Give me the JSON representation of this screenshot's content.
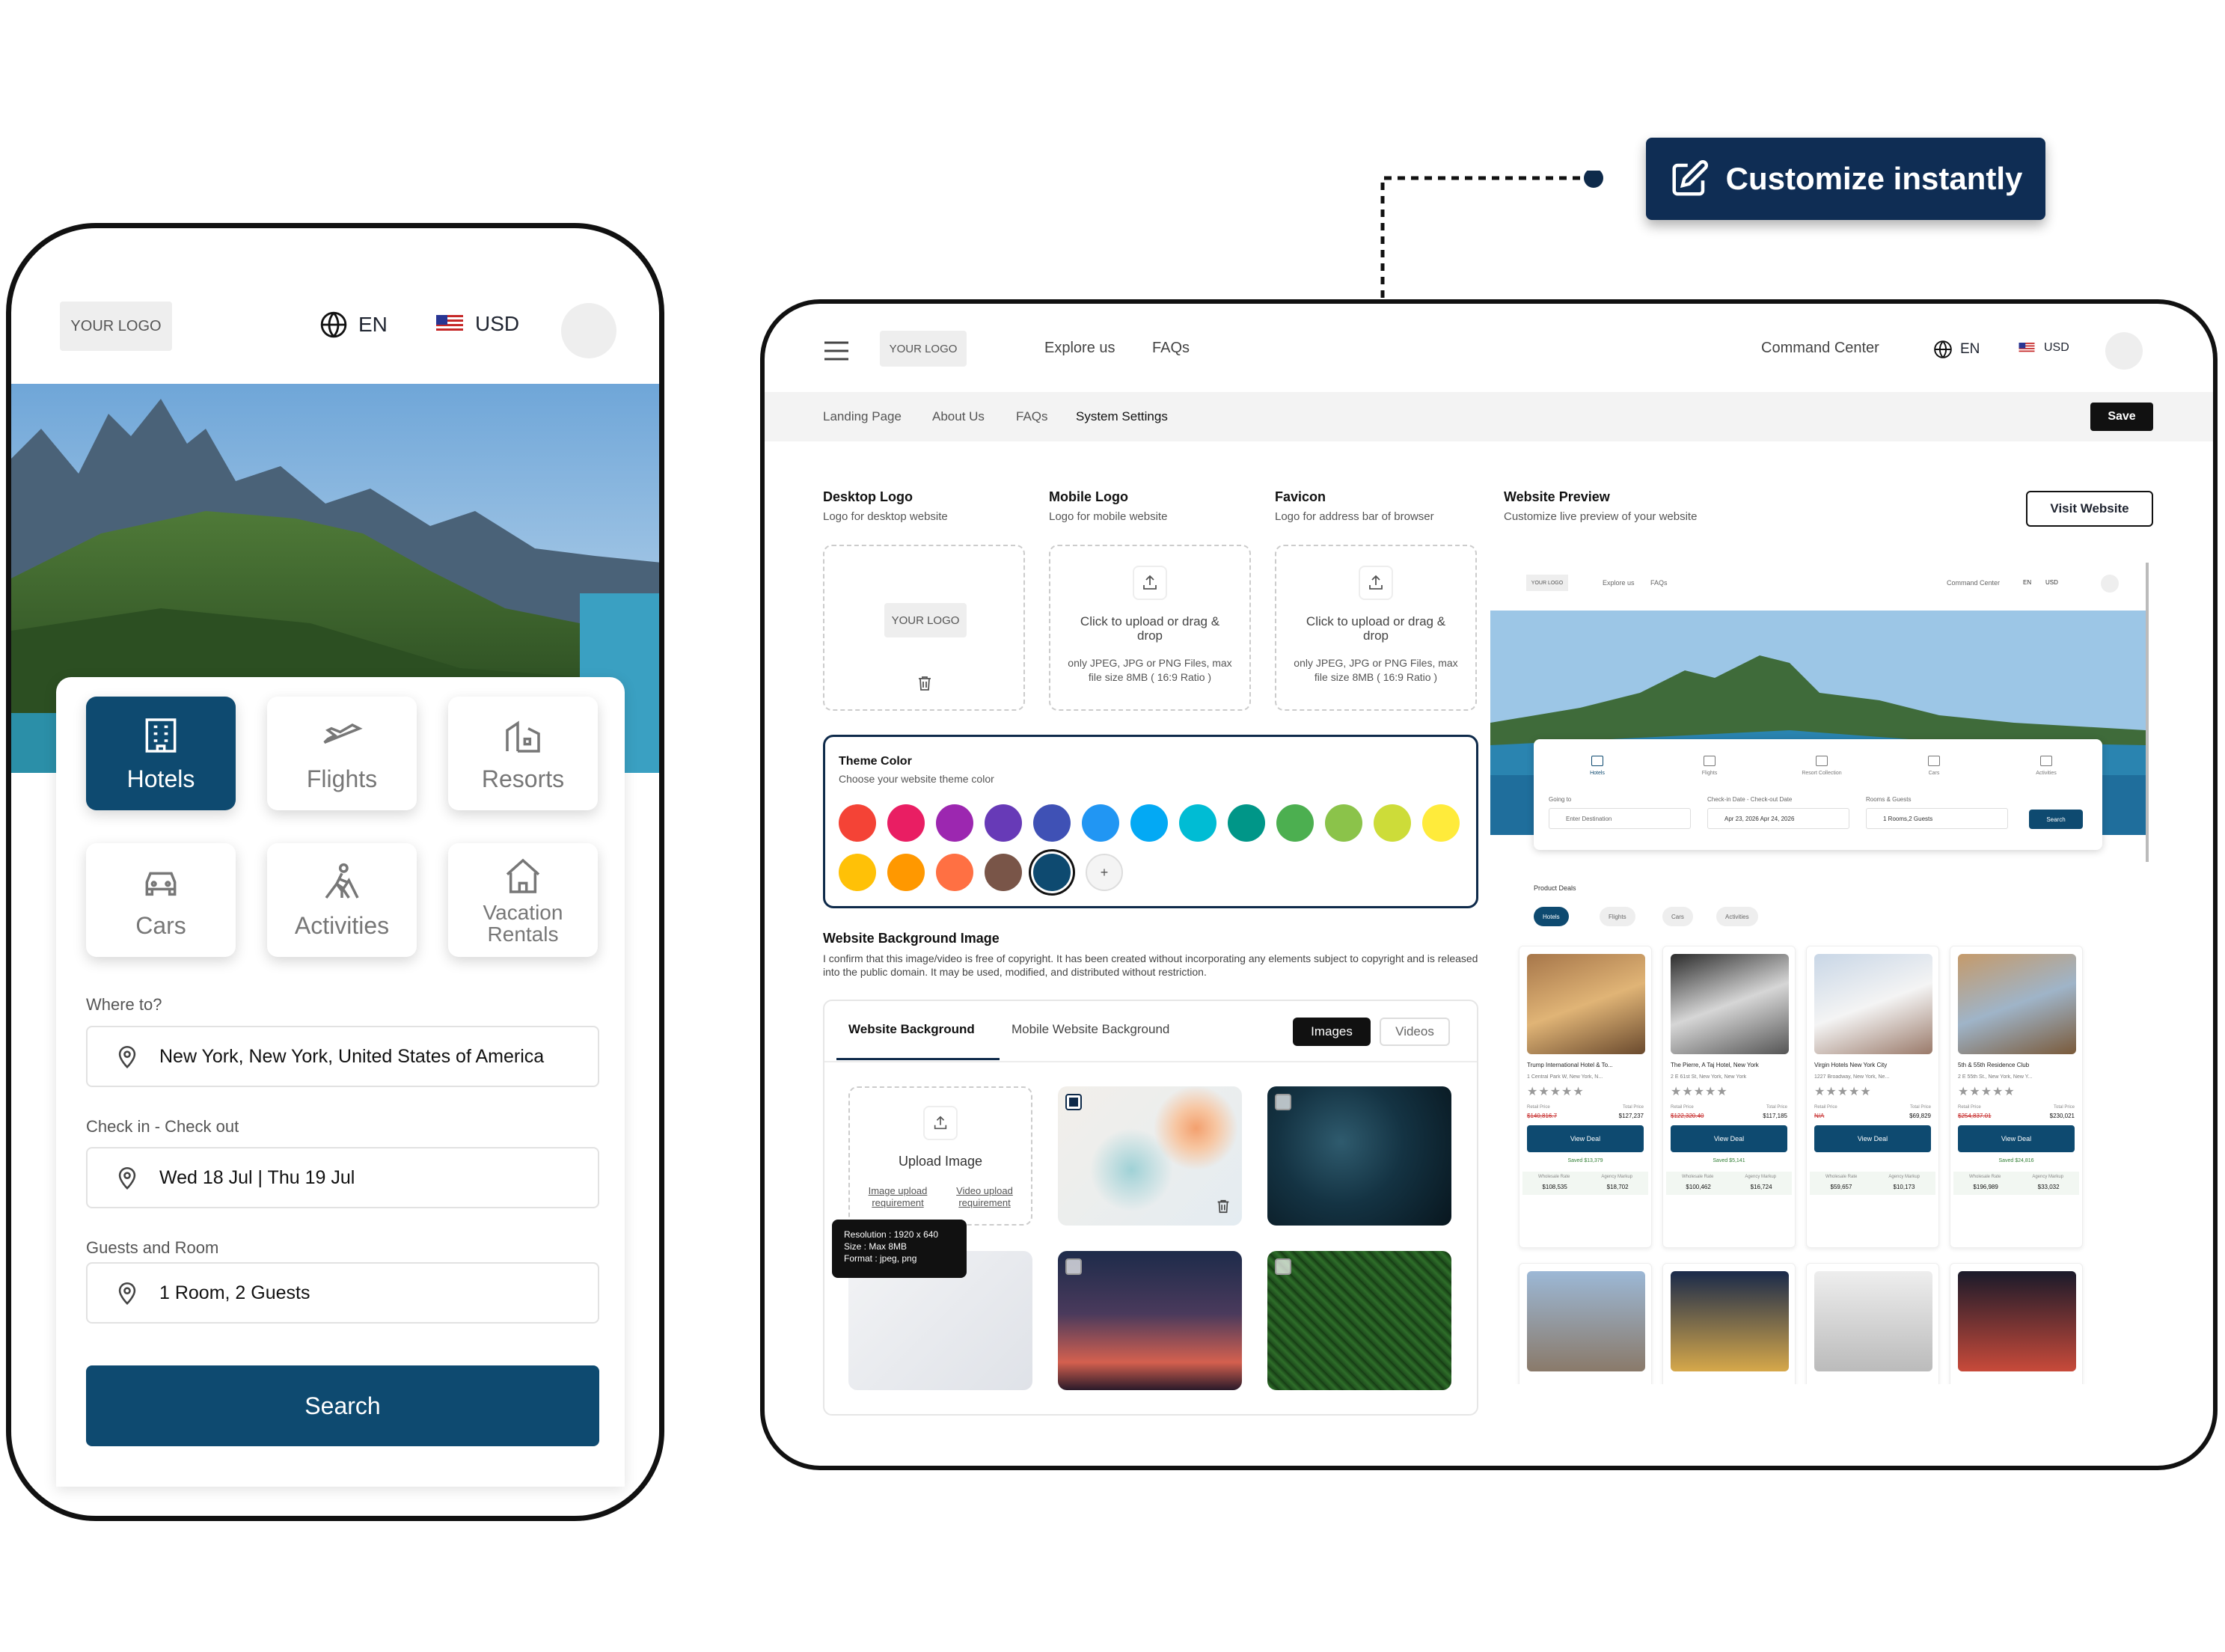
{
  "callout": {
    "label": "Customize instantly"
  },
  "mobile": {
    "logo": "YOUR LOGO",
    "language": "EN",
    "currency": "USD",
    "tiles": [
      {
        "label": "Hotels",
        "icon": "hotel-icon",
        "selected": true
      },
      {
        "label": "Flights",
        "icon": "plane-icon",
        "selected": false
      },
      {
        "label": "Resorts",
        "icon": "resort-icon",
        "selected": false
      },
      {
        "label": "Cars",
        "icon": "car-icon",
        "selected": false
      },
      {
        "label": "Activities",
        "icon": "hiker-icon",
        "selected": false
      },
      {
        "label": "Vacation Rentals",
        "icon": "house-icon",
        "selected": false
      }
    ],
    "where_label": "Where to?",
    "where_value": "New York, New York, United States of America",
    "dates_label": "Check in - Check out",
    "dates_value": "Wed 18 Jul | Thu 19 Jul",
    "guests_label": "Guests and Room",
    "guests_value": "1 Room, 2 Guests",
    "search_label": "Search",
    "accent": "#0e4a70"
  },
  "desktop": {
    "logo": "YOUR LOGO",
    "nav": [
      "Explore us",
      "FAQs"
    ],
    "command_center": "Command Center",
    "language": "EN",
    "currency": "USD",
    "subnav": [
      "Landing Page",
      "About Us",
      "FAQs",
      "System Settings"
    ],
    "save": "Save",
    "desktop_logo": {
      "title": "Desktop Logo",
      "subtitle": "Logo for desktop website",
      "logo": "YOUR LOGO"
    },
    "mobile_logo": {
      "title": "Mobile Logo",
      "subtitle": "Logo for mobile website",
      "upload": "Click to upload or drag & drop",
      "note": "only JPEG, JPG or PNG Files, max file size 8MB ( 16:9 Ratio )"
    },
    "favicon": {
      "title": "Favicon",
      "subtitle": "Logo for address bar of browser",
      "upload": "Click to upload or drag & drop",
      "note": "only JPEG, JPG or PNG Files, max file size 8MB ( 16:9 Ratio )"
    },
    "theme": {
      "title": "Theme Color",
      "subtitle": "Choose your website theme color",
      "colors": [
        "#f44336",
        "#e91e63",
        "#9c27b0",
        "#673ab7",
        "#3f51b5",
        "#2196f3",
        "#03a9f4",
        "#00bcd4",
        "#009688",
        "#4caf50",
        "#8bc34a",
        "#cddc39",
        "#ffeb3b",
        "#ffc107",
        "#ff9800",
        "#ff7043",
        "#795548",
        "#0e4a70"
      ],
      "selected": "#0e4a70",
      "add": "+"
    },
    "background": {
      "title": "Website Background Image",
      "text": "I confirm that this image/video is free of copyright. It has been created without incorporating any elements subject to copyright and is released into the public domain. It may be used, modified, and distributed without restriction.",
      "tabs": [
        "Website Background",
        "Mobile Website Background"
      ],
      "toggles": [
        "Images",
        "Videos"
      ],
      "upload": "Upload Image",
      "req1": "Image upload requirement",
      "req2": "Video upload requirement",
      "tooltip": [
        "Resolution : 1920 x 640",
        "Size : Max 8MB",
        "Format : jpeg, png"
      ]
    },
    "preview": {
      "title": "Website Preview",
      "subtitle": "Customize live preview of your website",
      "visit": "Visit Website",
      "mini_logo": "YOUR LOGO",
      "mini_nav": [
        "Explore us",
        "FAQs"
      ],
      "mini_cc": "Command Center",
      "mini_lang": "EN",
      "mini_cur": "USD",
      "mini_tabs": [
        "Hotels",
        "Flights",
        "Resort Collection",
        "Cars",
        "Activities"
      ],
      "going_label": "Going to",
      "going_value": "Enter Destination",
      "dates_label": "Check-in Date - Check-out Date",
      "dates_value": "Apr 23, 2026 Apr 24, 2026",
      "rooms_label": "Rooms & Guests",
      "rooms_value": "1 Rooms,2 Guests",
      "search": "Search",
      "deals_title": "Product Deals",
      "chips": [
        "Hotels",
        "Flights",
        "Cars",
        "Activities"
      ],
      "cards": [
        {
          "name": "Trump International Hotel & To...",
          "addr": "1 Central Park W, New York, N...",
          "retail": "$140,816.7",
          "total": "$127,237",
          "saved": "Saved $13,379",
          "wholesale": "$108,535",
          "markup": "$18,702"
        },
        {
          "name": "The Pierre, A Taj Hotel, New York",
          "addr": "2 E 61st St, New York, New York",
          "retail": "$122,320.40",
          "total": "$117,185",
          "saved": "Saved $5,141",
          "wholesale": "$100,462",
          "markup": "$16,724"
        },
        {
          "name": "Virgin Hotels New York City",
          "addr": "1227 Broadway, New York, Ne...",
          "retail": "N/A",
          "total": "$69,829",
          "saved": "",
          "wholesale": "$59,657",
          "markup": "$10,173"
        },
        {
          "name": "5th & 55th Residence Club",
          "addr": "2 E 55th St., New York, New Y...",
          "retail": "$254,837.01",
          "total": "$230,021",
          "saved": "Saved $24,816",
          "wholesale": "$196,989",
          "markup": "$33,032"
        }
      ],
      "retail_label": "Retail Price",
      "total_label": "Total Price",
      "view_deal": "View Deal",
      "wholesale_label": "Wholesale Rate",
      "markup_label": "Agency Markup"
    }
  }
}
